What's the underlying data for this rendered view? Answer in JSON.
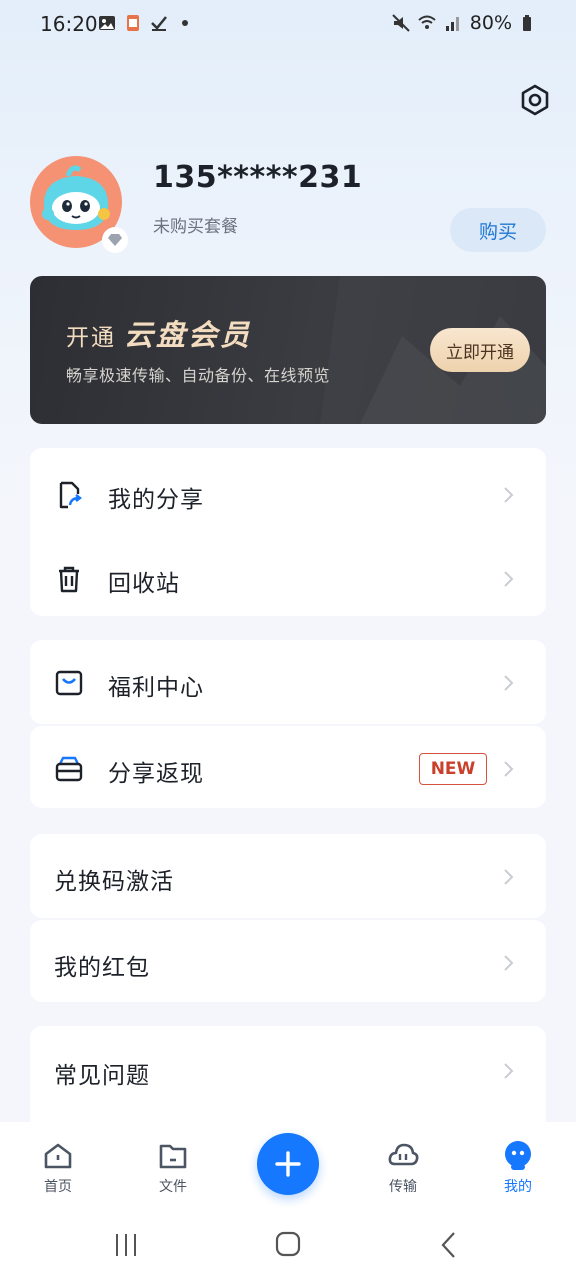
{
  "status_bar": {
    "time": "16:20",
    "battery": "80%"
  },
  "profile": {
    "phone": "135*****231",
    "plan": "未购买套餐",
    "buy_label": "购买"
  },
  "vip_banner": {
    "title_prefix": "开通",
    "title_main": "云盘会员",
    "subtitle": "畅享极速传输、自动备份、在线预览",
    "button": "立即开通"
  },
  "menu_groups": [
    {
      "items": [
        {
          "label": "我的分享",
          "icon": "share-file-icon"
        },
        {
          "label": "回收站",
          "icon": "trash-icon"
        }
      ]
    },
    {
      "items": [
        {
          "label": "福利中心",
          "icon": "gift-box-icon"
        }
      ]
    },
    {
      "items": [
        {
          "label": "分享返现",
          "icon": "cashback-icon",
          "badge": "NEW"
        }
      ]
    },
    {
      "items": [
        {
          "label": "兑换码激活"
        }
      ]
    },
    {
      "items": [
        {
          "label": "我的红包"
        }
      ]
    },
    {
      "items": [
        {
          "label": "常见问题"
        }
      ]
    }
  ],
  "tabs": [
    {
      "label": "首页",
      "icon": "home-icon"
    },
    {
      "label": "文件",
      "icon": "folder-icon"
    },
    {
      "label": "传输",
      "icon": "cloud-transfer-icon"
    },
    {
      "label": "我的",
      "icon": "profile-mascot-icon",
      "active": true
    }
  ],
  "colors": {
    "accent": "#1677ff",
    "vip_gold": "#f3dcc0",
    "badge_red": "#c9412c"
  }
}
